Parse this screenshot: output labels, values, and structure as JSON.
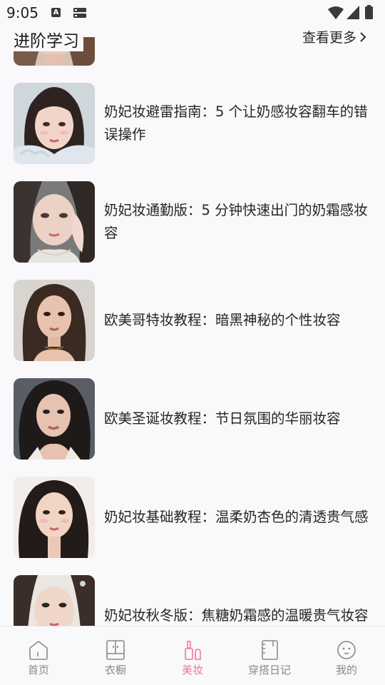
{
  "status_bar": {
    "time": "9:05",
    "notification_icons": [
      "text-a-icon",
      "sim-storage-icon"
    ],
    "system_icons": [
      "wifi-icon",
      "signal-icon",
      "battery-icon"
    ]
  },
  "section": {
    "title": "进阶学习",
    "more_label": "查看更多"
  },
  "articles": [
    {
      "title": "奶妃妆避雷指南：5 个让奶感妆容翻车的错误操作"
    },
    {
      "title": "奶妃妆通勤版：5 分钟快速出门的奶霜感妆容"
    },
    {
      "title": "欧美哥特妆教程：暗黑神秘的个性妆容"
    },
    {
      "title": "欧美圣诞妆教程：节日氛围的华丽妆容"
    },
    {
      "title": "奶妃妆基础教程：温柔奶杏色的清透贵气感"
    },
    {
      "title": "奶妃妆秋冬版：焦糖奶霜感的温暖贵气妆容"
    }
  ],
  "bottom_nav": {
    "items": [
      {
        "label": "首页",
        "icon": "home-icon",
        "active": false
      },
      {
        "label": "衣橱",
        "icon": "wardrobe-icon",
        "active": false
      },
      {
        "label": "美妆",
        "icon": "makeup-icon",
        "active": true
      },
      {
        "label": "穿搭日记",
        "icon": "diary-icon",
        "active": false
      },
      {
        "label": "我的",
        "icon": "profile-icon",
        "active": false
      }
    ]
  },
  "colors": {
    "background": "#f9f8fa",
    "accent": "#ec7a9c",
    "inactive": "#8a8a8a"
  }
}
